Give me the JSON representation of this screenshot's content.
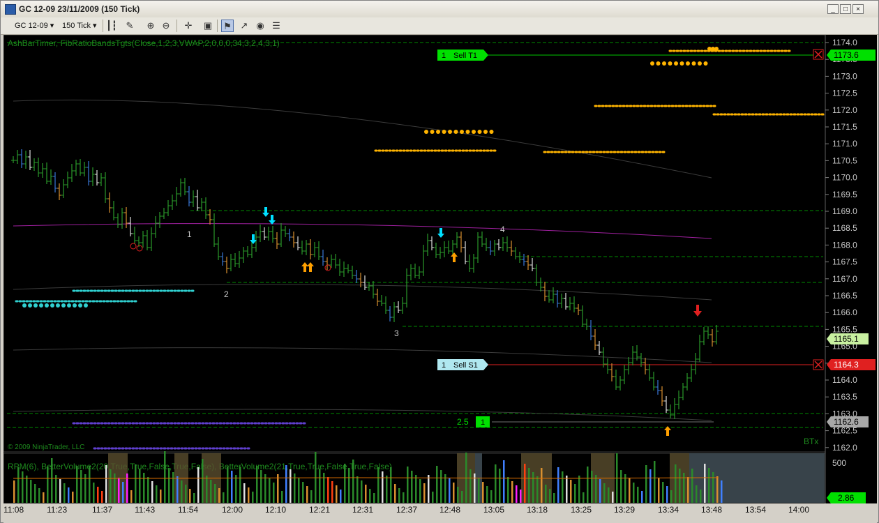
{
  "window": {
    "title": "GC 12-09  23/11/2009 (150 Tick)",
    "buttons": [
      "_",
      "□",
      "×"
    ]
  },
  "toolbar": {
    "instrument": "GC 12-09",
    "period": "150 Tick",
    "icons": [
      "bar-style-icon",
      "draw-pencil-icon",
      "zoom-in-icon",
      "zoom-out-icon",
      "crosshair-icon",
      "properties-icon",
      "strategy-icon",
      "indicator-icon",
      "chart-trader-icon",
      "data-box-icon"
    ]
  },
  "chart": {
    "indicator_label": "AshBarTimer, FibRatioBandsTgts(Close,1,2,3,VWAP,2,0,0,0,34,3,2,4,3,1)",
    "copyright": "© 2009 NinjaTrader, LLC",
    "btx": "BTx",
    "volume_label": "RPM(6),  BetterVolume2(20,True,True,False,True,False),  BetterVolume2(21,True,True,False,True,False)",
    "price_axis": [
      "1174.0",
      "1173.5",
      "1173.0",
      "1172.5",
      "1172.0",
      "1171.5",
      "1171.0",
      "1170.5",
      "1170.0",
      "1169.5",
      "1169.0",
      "1168.5",
      "1168.0",
      "1167.5",
      "1167.0",
      "1166.5",
      "1166.0",
      "1165.5",
      "1165.0",
      "1164.5",
      "1164.0",
      "1163.5",
      "1163.0",
      "1162.5",
      "1162.0"
    ],
    "price_markers": {
      "sell_t1": "1173.6",
      "last": "1165.1",
      "sell_s1": "1164.3",
      "bottom": "1162.6"
    },
    "volume_axis": "500",
    "volume_marker": "2.86",
    "orders": {
      "t1_qty": "1",
      "t1_label": "Sell T1",
      "s1_qty": "1",
      "s1_label": "Sell S1",
      "pos_avg": "2.5",
      "pos_qty": "1"
    },
    "wave_labels": [
      "1",
      "2",
      "3",
      "4"
    ],
    "time_axis": [
      "11:08",
      "11:23",
      "11:37",
      "11:43",
      "11:54",
      "12:00",
      "12:10",
      "12:21",
      "12:31",
      "12:37",
      "12:48",
      "13:05",
      "13:18",
      "13:25",
      "13:29",
      "13:34",
      "13:48",
      "13:54",
      "14:00"
    ],
    "colors": {
      "background": "#000000",
      "axis_text": "#c8c8c8",
      "sell_t1": "#00c800",
      "sell_s1": "#ff2020",
      "target_dots": "#ffb400",
      "cyan_dots": "#30d0d0",
      "vwap": "#a020a0",
      "green_dashed": "#008c00"
    }
  }
}
